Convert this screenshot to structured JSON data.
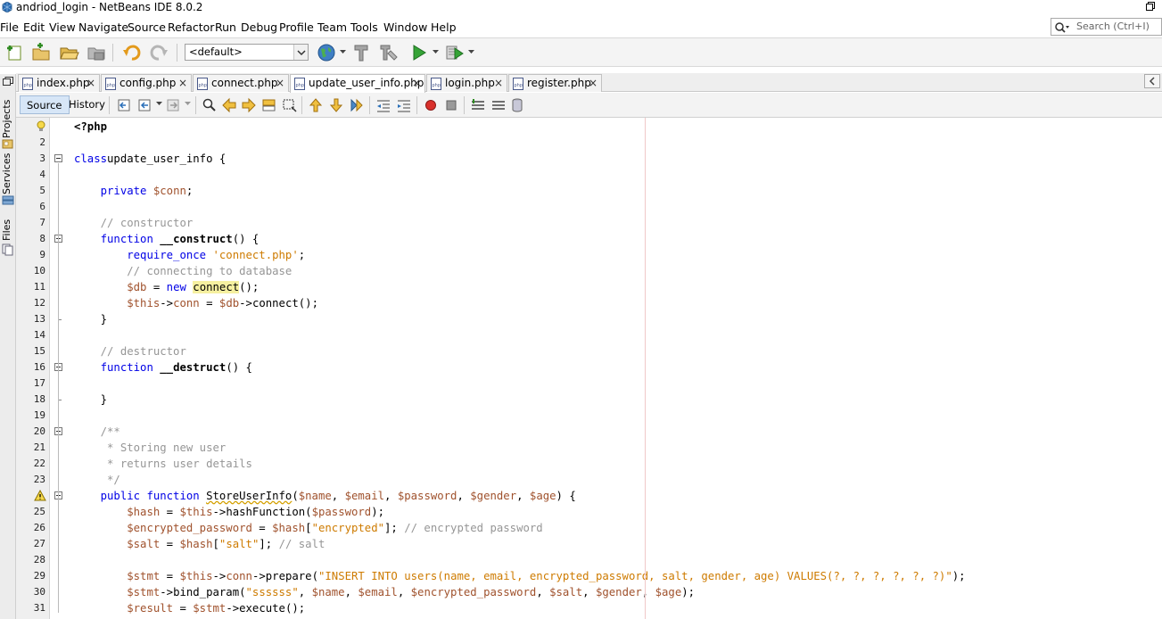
{
  "window": {
    "title": "andriod_login - NetBeans IDE 8.0.2"
  },
  "menu": [
    "File",
    "Edit",
    "View",
    "Navigate",
    "Source",
    "Refactor",
    "Run",
    "Debug",
    "Profile",
    "Team",
    "Tools",
    "Window",
    "Help"
  ],
  "search": {
    "placeholder": "Search (Ctrl+I)"
  },
  "toolbar": {
    "config_value": "<default>",
    "icons": [
      "new-file-icon",
      "new-project-icon",
      "open-project-icon",
      "close-project-icon",
      "undo-icon",
      "redo-icon",
      "browser-icon",
      "clean-build-icon",
      "build-icon",
      "run-icon",
      "debug-icon"
    ]
  },
  "side_tabs": [
    "Projects",
    "Services",
    "Files"
  ],
  "tabs": [
    {
      "label": "index.php",
      "active": false
    },
    {
      "label": "config.php",
      "active": false
    },
    {
      "label": "connect.php",
      "active": false
    },
    {
      "label": "update_user_info.php",
      "active": true
    },
    {
      "label": "login.php",
      "active": false
    },
    {
      "label": "register.php",
      "active": false
    }
  ],
  "editor_toolbar": {
    "source_label": "Source",
    "history_label": "History"
  },
  "colors": {
    "keyword": "#0000e6",
    "variable": "#a0522d",
    "string": "#ce7b00",
    "comment": "#969696",
    "margin": "#f0c8c8"
  },
  "code": {
    "line_numbers": [
      1,
      2,
      3,
      4,
      5,
      6,
      7,
      8,
      9,
      10,
      11,
      12,
      13,
      14,
      15,
      16,
      17,
      18,
      19,
      20,
      21,
      22,
      23,
      24,
      25,
      26,
      27,
      28,
      29,
      30,
      31
    ],
    "gutter_markers": {
      "1": "bulb-icon",
      "24": "warning-icon"
    },
    "lines": [
      [
        [
          "tag",
          "<?php"
        ]
      ],
      [],
      [
        [
          "kw",
          "class"
        ],
        [
          "",
          "update_user_info {"
        ]
      ],
      [],
      [
        [
          "",
          "    "
        ],
        [
          "kw",
          "private"
        ],
        [
          "",
          ""
        ],
        [
          "var",
          " $conn"
        ],
        [
          "",
          ";"
        ]
      ],
      [],
      [
        [
          "",
          "    "
        ],
        [
          "cmt",
          "// constructor"
        ]
      ],
      [
        [
          "",
          "    "
        ],
        [
          "kw",
          "function"
        ],
        [
          "",
          " "
        ],
        [
          "fn",
          "__construct"
        ],
        [
          "",
          "() {"
        ]
      ],
      [
        [
          "",
          "        "
        ],
        [
          "kw",
          "require_once"
        ],
        [
          "",
          " "
        ],
        [
          "str",
          "'connect.php'"
        ],
        [
          "",
          ";"
        ]
      ],
      [
        [
          "",
          "        "
        ],
        [
          "cmt",
          "// connecting to database"
        ]
      ],
      [
        [
          "",
          "        "
        ],
        [
          "var",
          "$db"
        ],
        [
          "",
          " = "
        ],
        [
          "kw",
          "new"
        ],
        [
          "",
          " "
        ],
        [
          "hl",
          "connect"
        ],
        [
          "",
          "();"
        ]
      ],
      [
        [
          "",
          "        "
        ],
        [
          "var",
          "$this"
        ],
        [
          "",
          "->"
        ],
        [
          "var",
          "conn"
        ],
        [
          "",
          " = "
        ],
        [
          "var",
          "$db"
        ],
        [
          "",
          "->connect();"
        ]
      ],
      [
        [
          "",
          "    }"
        ]
      ],
      [],
      [
        [
          "",
          "    "
        ],
        [
          "cmt",
          "// destructor"
        ]
      ],
      [
        [
          "",
          "    "
        ],
        [
          "kw",
          "function"
        ],
        [
          "",
          " "
        ],
        [
          "fn",
          "__destruct"
        ],
        [
          "",
          "() {"
        ]
      ],
      [],
      [
        [
          "",
          "    }"
        ]
      ],
      [],
      [
        [
          "",
          "    "
        ],
        [
          "cmt",
          "/**"
        ]
      ],
      [
        [
          "",
          "    "
        ],
        [
          "cmt",
          " * Storing new user"
        ]
      ],
      [
        [
          "",
          "    "
        ],
        [
          "cmt",
          " * returns user details"
        ]
      ],
      [
        [
          "",
          "    "
        ],
        [
          "cmt",
          " */"
        ]
      ],
      [
        [
          "",
          "    "
        ],
        [
          "kw",
          "public function"
        ],
        [
          "",
          " "
        ],
        [
          "wavy",
          "StoreUserInfo"
        ],
        [
          "",
          "("
        ],
        [
          "var",
          "$name"
        ],
        [
          "",
          ", "
        ],
        [
          "var",
          "$email"
        ],
        [
          "",
          ", "
        ],
        [
          "var",
          "$password"
        ],
        [
          "",
          ", "
        ],
        [
          "var",
          "$gender"
        ],
        [
          "",
          ", "
        ],
        [
          "var",
          "$age"
        ],
        [
          "",
          ") {"
        ]
      ],
      [
        [
          "",
          "        "
        ],
        [
          "var",
          "$hash"
        ],
        [
          "",
          " = "
        ],
        [
          "var",
          "$this"
        ],
        [
          "",
          "->hashFunction("
        ],
        [
          "var",
          "$password"
        ],
        [
          "",
          ");"
        ]
      ],
      [
        [
          "",
          "        "
        ],
        [
          "var",
          "$encrypted_password"
        ],
        [
          "",
          " = "
        ],
        [
          "var",
          "$hash"
        ],
        [
          "",
          "["
        ],
        [
          "str",
          "\"encrypted\""
        ],
        [
          "",
          "]; "
        ],
        [
          "cmt",
          "// encrypted password"
        ]
      ],
      [
        [
          "",
          "        "
        ],
        [
          "var",
          "$salt"
        ],
        [
          "",
          " = "
        ],
        [
          "var",
          "$hash"
        ],
        [
          "",
          "["
        ],
        [
          "str",
          "\"salt\""
        ],
        [
          "",
          "]; "
        ],
        [
          "cmt",
          "// salt"
        ]
      ],
      [],
      [
        [
          "",
          "        "
        ],
        [
          "var",
          "$stmt"
        ],
        [
          "",
          " = "
        ],
        [
          "var",
          "$this"
        ],
        [
          "",
          "->"
        ],
        [
          "var",
          "conn"
        ],
        [
          "",
          "->prepare("
        ],
        [
          "str",
          "\"INSERT INTO users(name, email, encrypted_password, salt, gender, age) VALUES(?, ?, ?, ?, ?, ?)\""
        ],
        [
          "",
          ");"
        ]
      ],
      [
        [
          "",
          "        "
        ],
        [
          "var",
          "$stmt"
        ],
        [
          "",
          "->bind_param("
        ],
        [
          "str",
          "\"ssssss\""
        ],
        [
          "",
          ", "
        ],
        [
          "var",
          "$name"
        ],
        [
          "",
          ", "
        ],
        [
          "var",
          "$email"
        ],
        [
          "",
          ", "
        ],
        [
          "var",
          "$encrypted_password"
        ],
        [
          "",
          ", "
        ],
        [
          "var",
          "$salt"
        ],
        [
          "",
          ", "
        ],
        [
          "var",
          "$gender"
        ],
        [
          "",
          ", "
        ],
        [
          "var",
          "$age"
        ],
        [
          "",
          ");"
        ]
      ],
      [
        [
          "",
          "        "
        ],
        [
          "var",
          "$result"
        ],
        [
          "",
          " = "
        ],
        [
          "var",
          "$stmt"
        ],
        [
          "",
          "->execute();"
        ]
      ]
    ]
  }
}
